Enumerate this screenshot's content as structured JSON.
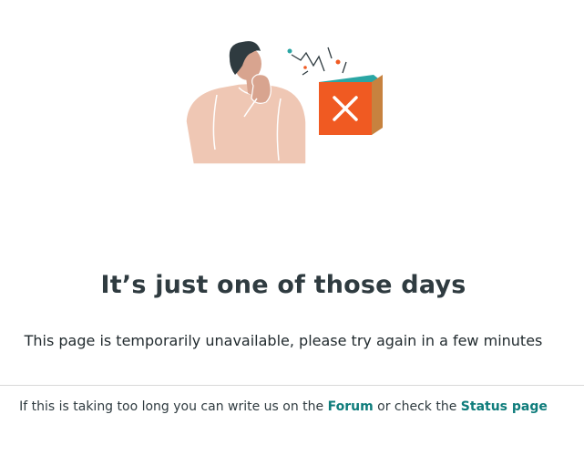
{
  "main": {
    "title": "It’s just one of those days",
    "subtitle": "This page is temporarily unavailable, please try again in a few minutes"
  },
  "footer": {
    "text_before": "If this is taking too long you can write us on the ",
    "forum_link": "Forum",
    "text_middle": " or check the ",
    "status_link": "Status page"
  },
  "colors": {
    "title": "#2f3b40",
    "link": "#0e7c7b",
    "box_front": "#f05a22",
    "box_top": "#2aa6a4",
    "box_side": "#c7823f",
    "skin": "#efc7b4"
  },
  "illustration": {
    "icon": "thinking-person-error-box-illustration"
  }
}
